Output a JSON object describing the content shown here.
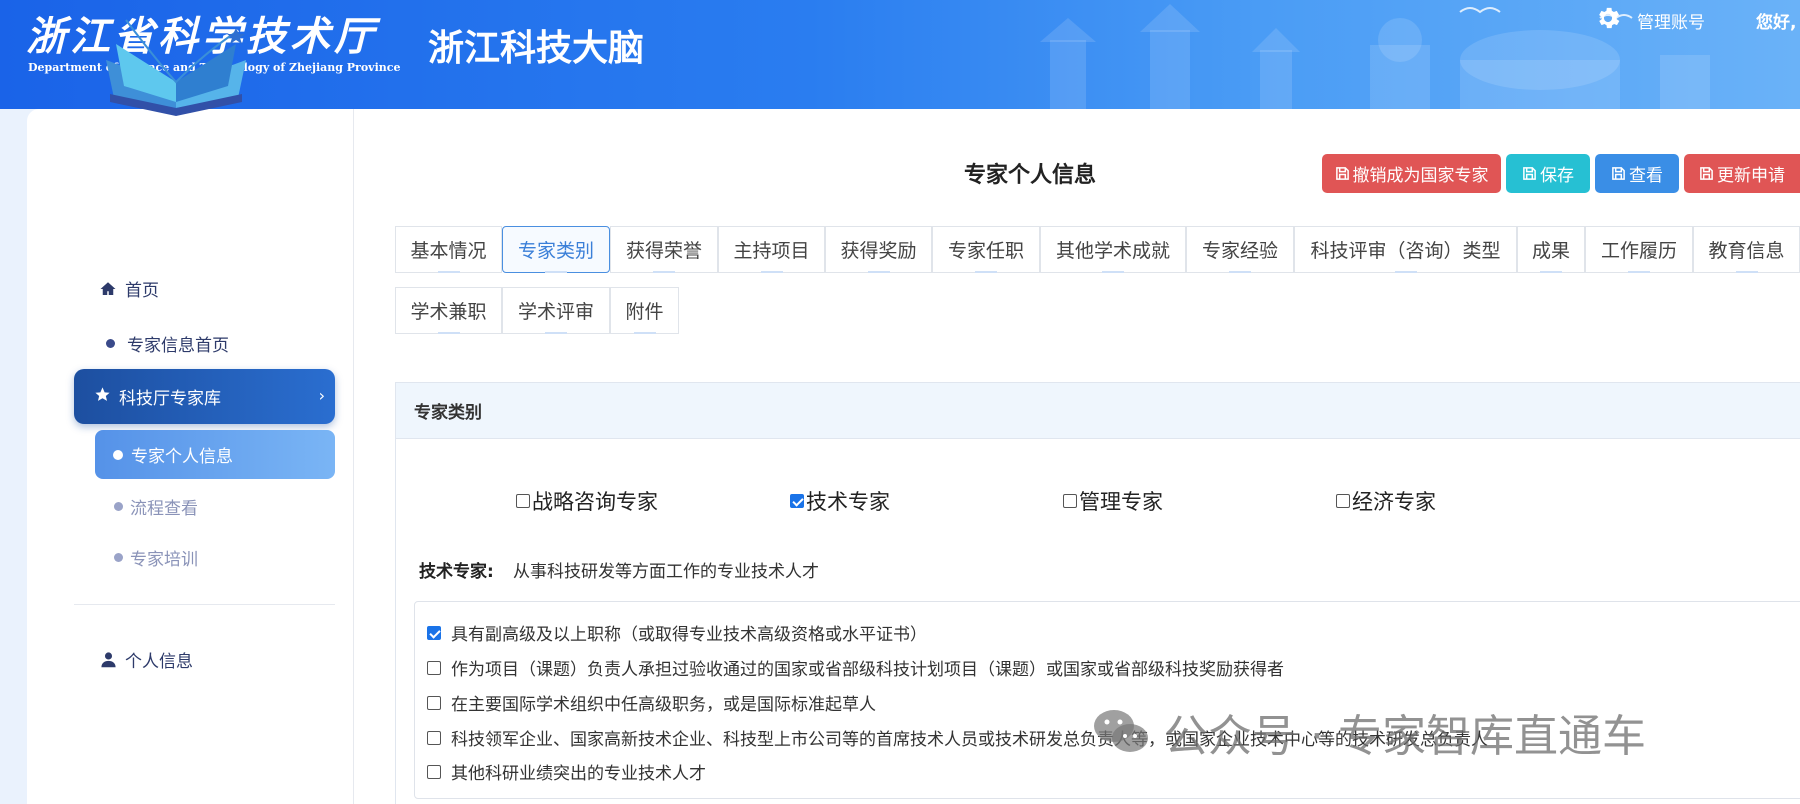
{
  "header": {
    "org_name_cn": "浙江省科学技术厅",
    "org_name_en": "Department of Science and Technology of Zhejiang Province",
    "app_title": "浙江科技大脑",
    "account_label": "管理账号",
    "greeting": "您好,"
  },
  "sidebar": {
    "home": "首页",
    "expert_home": "专家信息首页",
    "expert_library": "科技厅专家库",
    "expert_personal_info": "专家个人信息",
    "process_view": "流程查看",
    "expert_training": "专家培训",
    "personal_info": "个人信息"
  },
  "main": {
    "title": "专家个人信息",
    "buttons": {
      "revoke": "撤销成为国家专家",
      "save": "保存",
      "view": "查看",
      "update": "更新申请"
    },
    "tabs": [
      "基本情况",
      "专家类别",
      "获得荣誉",
      "主持项目",
      "获得奖励",
      "专家任职",
      "其他学术成就",
      "专家经验",
      "科技评审（咨询）类型",
      "成果",
      "工作履历",
      "教育信息",
      "学术兼职",
      "学术评审",
      "附件"
    ],
    "active_tab": "专家类别",
    "section_title": "专家类别",
    "categories": [
      {
        "label": "战略咨询专家",
        "checked": false
      },
      {
        "label": "技术专家",
        "checked": true
      },
      {
        "label": "管理专家",
        "checked": false
      },
      {
        "label": "经济专家",
        "checked": false
      }
    ],
    "definition_label": "技术专家:",
    "definition_text": "从事科技研发等方面工作的专业技术人才",
    "criteria": [
      {
        "text": "具有副高级及以上职称（或取得专业技术高级资格或水平证书）",
        "checked": true
      },
      {
        "text": "作为项目（课题）负责人承担过验收通过的国家或省部级科技计划项目（课题）或国家或省部级科技奖励获得者",
        "checked": false
      },
      {
        "text": "在主要国际学术组织中任高级职务，或是国际标准起草人",
        "checked": false
      },
      {
        "text": "科技领军企业、国家高新技术企业、科技型上市公司等的首席技术人员或技术研发总负责人等，或国家企业技术中心等的技术研发总负责人",
        "checked": false
      },
      {
        "text": "其他科研业绩突出的专业技术人才",
        "checked": false
      }
    ]
  },
  "watermark": {
    "text": "公众号 · 专家智库直通车"
  },
  "colors": {
    "header_blue": "#1a63e8",
    "btn_red": "#e05555",
    "btn_cyan": "#26c0d3",
    "btn_blue": "#3a8ee6",
    "nav_active": "#1d4fa0"
  }
}
